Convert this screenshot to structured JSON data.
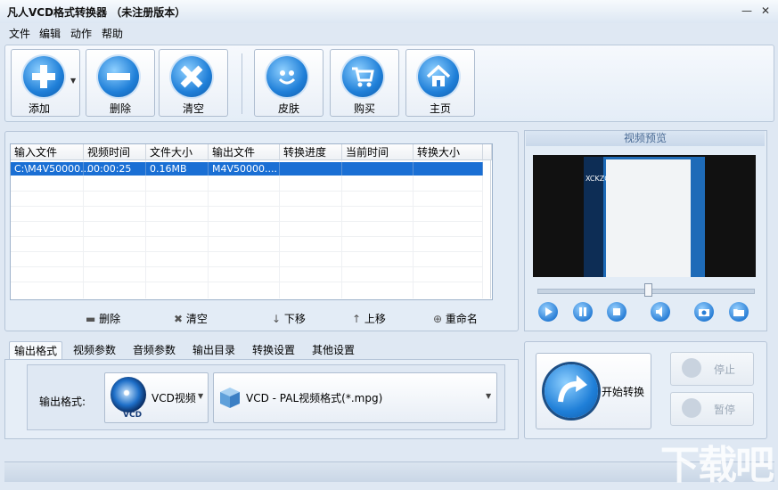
{
  "window": {
    "title": "凡人VCD格式转换器 （未注册版本）",
    "minimize": "—",
    "close": "✕"
  },
  "menu": [
    "文件",
    "编辑",
    "动作",
    "帮助"
  ],
  "toolbar": {
    "add": "添加",
    "delete": "删除",
    "clear": "清空",
    "skin": "皮肤",
    "buy": "购买",
    "home": "主页"
  },
  "table": {
    "columns": [
      "输入文件",
      "视频时间",
      "文件大小",
      "输出文件",
      "转换进度",
      "当前时间",
      "转换大小"
    ],
    "rows": [
      {
        "input": "C:\\M4V50000...",
        "duration": "00:00:25",
        "size": "0.16MB",
        "output": "M4V50000....",
        "progress": "",
        "current": "",
        "converted": ""
      }
    ]
  },
  "list_actions": {
    "delete": "删除",
    "clear": "清空",
    "down": "下移",
    "up": "上移",
    "rename": "重命名"
  },
  "tabs": [
    "输出格式",
    "视频参数",
    "音频参数",
    "输出目录",
    "转换设置",
    "其他设置"
  ],
  "format": {
    "label": "输出格式:",
    "type": "VCD视频",
    "type_icon_text": "VCD",
    "preset": "VCD - PAL视频格式(*.mpg)"
  },
  "preview": {
    "title": "视频预览",
    "video_text": "XCKZQ"
  },
  "convert": {
    "start": "开始转换",
    "stop": "停止",
    "pause": "暂停"
  },
  "watermark": "下载吧",
  "colors": {
    "accent": "#1a6fd4",
    "panel": "#e3ecf6",
    "title_text": "#4a6b95"
  }
}
